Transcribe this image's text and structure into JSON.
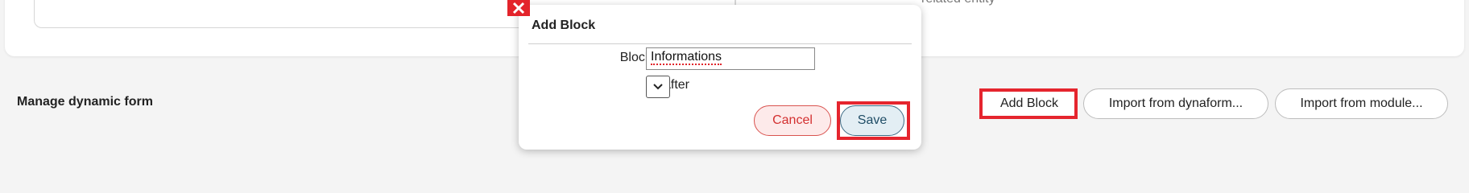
{
  "background": {
    "related_text": "related entity"
  },
  "manage": {
    "label": "Manage dynamic form",
    "buttons": {
      "add_block": "Add Block",
      "import_dynaform": "Import from dynaform...",
      "import_module": "Import from module..."
    }
  },
  "modal": {
    "title": "Add Block",
    "close_icon": "close-x-icon",
    "fields": {
      "block_name_label": "Block Name",
      "block_name_value": "Informations",
      "after_label": "After",
      "after_selected": ""
    },
    "buttons": {
      "cancel": "Cancel",
      "save": "Save"
    }
  },
  "colors": {
    "highlight": "#e5252e",
    "cancel_text": "#d32f2f",
    "save_border": "#3d6b85"
  }
}
